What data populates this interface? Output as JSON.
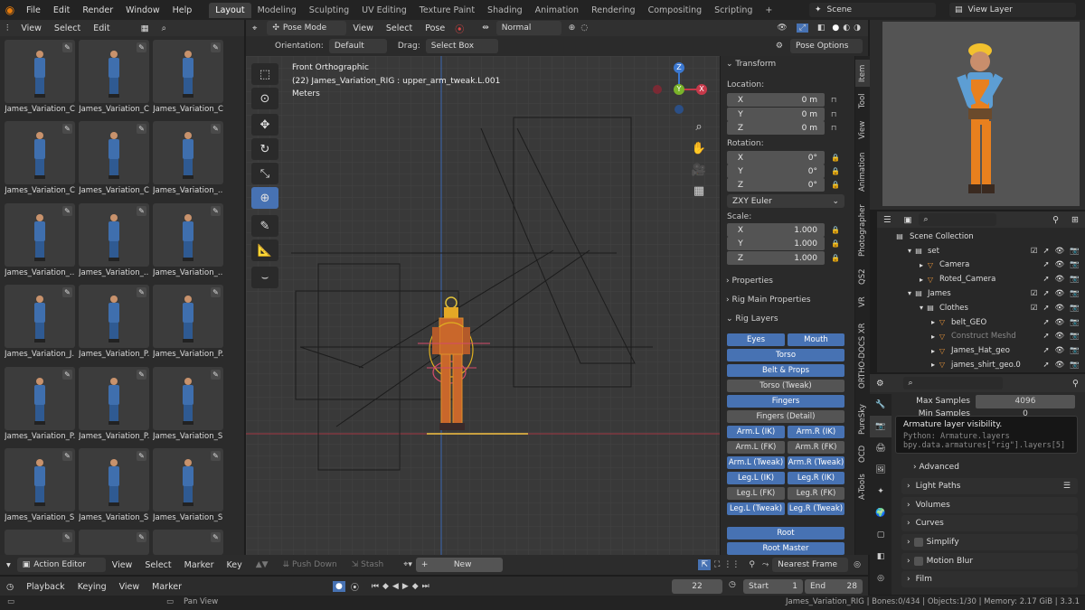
{
  "topbar": {
    "menus": [
      "File",
      "Edit",
      "Render",
      "Window",
      "Help"
    ],
    "workspaces": [
      "Layout",
      "Modeling",
      "Sculpting",
      "UV Editing",
      "Texture Paint",
      "Shading",
      "Animation",
      "Rendering",
      "Compositing",
      "Scripting"
    ],
    "active_workspace": "Layout",
    "add_tab": "+",
    "scene": "Scene",
    "view_layer": "View Layer"
  },
  "left_header": {
    "menus": [
      "View",
      "Select",
      "Edit"
    ]
  },
  "asset_thumbs": [
    "James_Variation_C",
    "James_Variation_C",
    "James_Variation_C",
    "James_Variation_C",
    "James_Variation_C",
    "James_Variation_...",
    "James_Variation_...",
    "James_Variation_...",
    "James_Variation_...",
    "James_Variation_J...",
    "James_Variation_P...",
    "James_Variation_P...",
    "James_Variation_P...",
    "James_Variation_P...",
    "James_Variation_S...",
    "James_Variation_S...",
    "James_Variation_S...",
    "James_Variation_S..."
  ],
  "viewport_header": {
    "mode": "Pose Mode",
    "menus": [
      "View",
      "Select",
      "Pose"
    ],
    "shading": "Normal",
    "orientation_label": "Orientation:",
    "orientation": "Default",
    "drag_label": "Drag:",
    "drag": "Select Box",
    "pose_options": "Pose Options"
  },
  "viewport_overlay": {
    "view": "Front Orthographic",
    "object": "(22) James_Variation_RIG : upper_arm_tweak.L.001",
    "units": "Meters"
  },
  "gizmo": {
    "z": "Z",
    "y": "Y",
    "x": "X"
  },
  "npanel": {
    "transform": "Transform",
    "location_label": "Location:",
    "location": [
      {
        "axis": "X",
        "value": "0 m"
      },
      {
        "axis": "Y",
        "value": "0 m"
      },
      {
        "axis": "Z",
        "value": "0 m"
      }
    ],
    "rotation_label": "Rotation:",
    "rotation": [
      {
        "axis": "X",
        "value": "0°"
      },
      {
        "axis": "Y",
        "value": "0°"
      },
      {
        "axis": "Z",
        "value": "0°"
      }
    ],
    "rotation_mode": "ZXY Euler",
    "scale_label": "Scale:",
    "scale": [
      {
        "axis": "X",
        "value": "1.000"
      },
      {
        "axis": "Y",
        "value": "1.000"
      },
      {
        "axis": "Z",
        "value": "1.000"
      }
    ],
    "properties": "Properties",
    "rig_main": "Rig Main Properties",
    "rig_layers": "Rig Layers",
    "buttons": {
      "eyes": "Eyes",
      "mouth": "Mouth",
      "torso": "Torso",
      "belt": "Belt & Props",
      "torso_tweak": "Torso (Tweak)",
      "fingers": "Fingers",
      "fingers_detail": "Fingers (Detail)",
      "arm_l_ik": "Arm.L (IK)",
      "arm_r_ik": "Arm.R (IK)",
      "arm_l_fk": "Arm.L (FK)",
      "arm_r_fk": "Arm.R (FK)",
      "arm_l_tweak": "Arm.L (Tweak)",
      "arm_r_tweak": "Arm.R (Tweak)",
      "leg_l_ik": "Leg.L (IK)",
      "leg_r_ik": "Leg.R (IK)",
      "leg_l_fk": "Leg.L (FK)",
      "leg_r_fk": "Leg.R (FK)",
      "leg_l_tweak": "Leg.L (Tweak)",
      "leg_r_tweak": "Leg.R (Tweak)",
      "root": "Root",
      "root_master": "Root Master"
    }
  },
  "vtabs": [
    "Item",
    "Tool",
    "View",
    "Animation",
    "Photographer",
    "QS2",
    "VR",
    "ORTHO-DOCS XR",
    "PureSky",
    "OCD",
    "A-Tools"
  ],
  "outliner": {
    "scene_collection": "Scene Collection",
    "rows": [
      {
        "name": "set",
        "indent": 1
      },
      {
        "name": "Camera",
        "indent": 2
      },
      {
        "name": "Roted_Camera",
        "indent": 2
      },
      {
        "name": "James",
        "indent": 1
      },
      {
        "name": "Clothes",
        "indent": 2
      },
      {
        "name": "belt_GEO",
        "indent": 3
      },
      {
        "name": "Construct Meshd",
        "indent": 3
      },
      {
        "name": "James_Hat_geo",
        "indent": 3
      },
      {
        "name": "james_shirt_geo.0",
        "indent": 3
      }
    ]
  },
  "properties": {
    "max_samples_label": "Max Samples",
    "max_samples": "4096",
    "min_samples_label": "Min Samples",
    "min_samples": "0",
    "tooltip_title": "Armature layer visibility.",
    "tooltip_python": "Python: Armature.layers",
    "tooltip_path": "bpy.data.armatures[\"rig\"].layers[5]",
    "advanced": "Advanced",
    "sections": [
      "Light Paths",
      "Volumes",
      "Curves",
      "Simplify",
      "Motion Blur",
      "Film"
    ]
  },
  "action_editor": {
    "editor": "Action Editor",
    "menus": [
      "View",
      "Select",
      "Marker",
      "Key"
    ],
    "push_down": "Push Down",
    "stash": "Stash",
    "new": "New",
    "snap": "Nearest Frame"
  },
  "timeline": {
    "menus": [
      "Playback",
      "Keying",
      "View",
      "Marker"
    ],
    "current_frame": "22",
    "start_label": "Start",
    "start": "1",
    "end_label": "End",
    "end": "28"
  },
  "status": {
    "hint": "Pan View",
    "info": "James_Variation_RIG | Bones:0/434 | Objects:1/30 | Memory: 2.17 GiB | 3.3.1"
  },
  "colors": {
    "accent": "#4772b3",
    "x_axis": "#c6394a",
    "y_axis": "#7ab32a",
    "z_axis": "#3b78d1"
  }
}
